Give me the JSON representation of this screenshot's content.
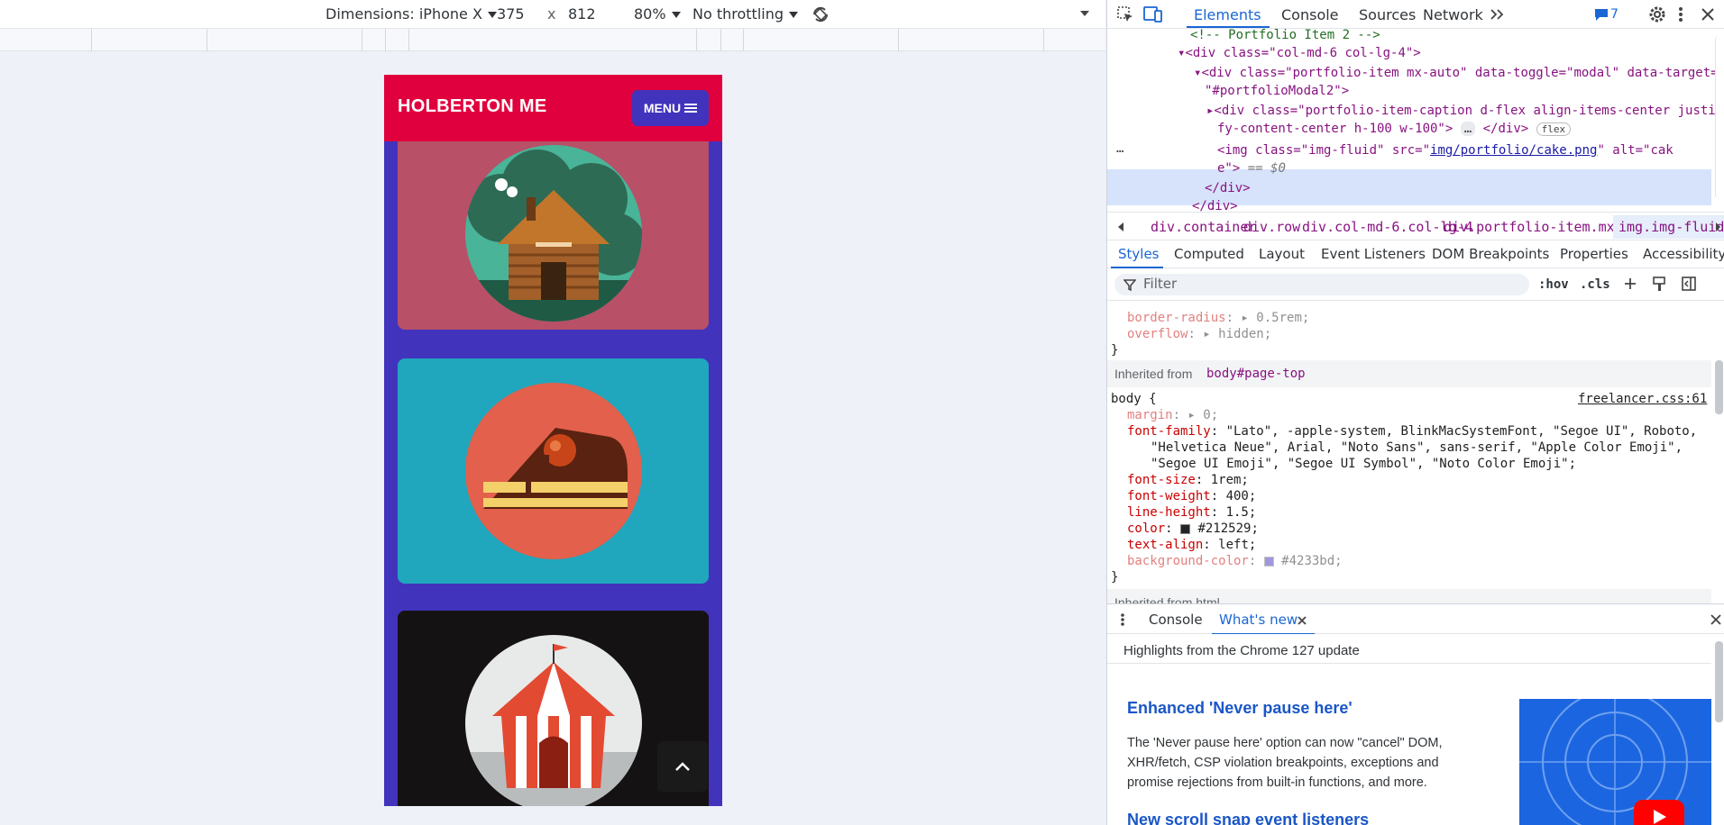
{
  "device_toolbar": {
    "dimensions_label": "Dimensions: iPhone X",
    "width": "375",
    "times": "x",
    "height": "812",
    "zoom": "80%",
    "throttling": "No throttling"
  },
  "phone": {
    "brand": "HOLBERTON ME",
    "menu_label": "MENU",
    "cards": [
      {
        "name": "cabin",
        "bg": "#b85068",
        "circle": "#49b497"
      },
      {
        "name": "cake",
        "bg": "#20a6bd",
        "circle": "#e2604c"
      },
      {
        "name": "circus",
        "bg": "#151213",
        "circle": "#e8eaea"
      }
    ],
    "colors": {
      "navbar": "#e0003d",
      "page_bg": "#4233bd"
    }
  },
  "devtools": {
    "tabs": [
      "Elements",
      "Console",
      "Sources",
      "Network"
    ],
    "active_tab": "Elements",
    "issues_count": "7",
    "dom": {
      "comment": "<!-- Portfolio Item 2 -->",
      "line2_tag": "<div class=\"col-md-6 col-lg-4\">",
      "line3a": "<div class=\"portfolio-item mx-auto\" data-toggle=\"modal\" data-target=",
      "line3b": "\"#portfolioModal2\">",
      "line4a": "<div class=\"portfolio-item-caption d-flex align-items-center justi",
      "line4b": "fy-content-center h-100 w-100\">",
      "line4_close": "</div>",
      "flex_badge": "flex",
      "img_a_start": "<img class=\"img-fluid\" src=\"",
      "img_src": "img/portfolio/cake.png",
      "img_a_end": "\" alt=\"cak",
      "img_b": "e\">",
      "img_eq": "== $0",
      "close_div1": "</div>",
      "close_div2": "</div>"
    },
    "breadcrumbs": [
      "div.container",
      "div.row",
      "div.col-md-6.col-lg-4",
      "div.portfolio-item.mx-auto",
      "img.img-fluid"
    ],
    "style_tabs": [
      "Styles",
      "Computed",
      "Layout",
      "Event Listeners",
      "DOM Breakpoints",
      "Properties",
      "Accessibility"
    ],
    "filter_placeholder": "Filter",
    "hov": ":hov",
    "cls": ".cls",
    "styles": {
      "top_props": [
        {
          "name": "border-radius",
          "value": "0.5rem"
        },
        {
          "name": "overflow",
          "value": "hidden"
        }
      ],
      "inherited_label": "Inherited from",
      "inherited_from": "body#page-top",
      "selector": "body {",
      "source": "freelancer.css:61",
      "body_props": [
        {
          "name": "margin",
          "value": "0;"
        },
        {
          "name": "font-family",
          "value": "\"Lato\", -apple-system, BlinkMacSystemFont, \"Segoe UI\", Roboto,"
        },
        {
          "name": "",
          "value": "\"Helvetica Neue\", Arial, \"Noto Sans\", sans-serif, \"Apple Color Emoji\","
        },
        {
          "name": "",
          "value": "\"Segoe UI Emoji\", \"Segoe UI Symbol\", \"Noto Color Emoji\";"
        },
        {
          "name": "font-size",
          "value": "1rem;"
        },
        {
          "name": "font-weight",
          "value": "400;"
        },
        {
          "name": "line-height",
          "value": "1.5;"
        },
        {
          "name": "color",
          "value": "#212529;"
        },
        {
          "name": "text-align",
          "value": "left;"
        },
        {
          "name": "background-color",
          "value": "#4233bd;"
        }
      ],
      "closing": "}",
      "inherited_html": "Inherited from html"
    },
    "drawer": {
      "tabs": [
        "Console",
        "What's new"
      ],
      "highlights": "Highlights from the Chrome 127 update",
      "article1_title": "Enhanced 'Never pause here'",
      "article1_body": "The 'Never pause here' option can now \"cancel\" DOM, XHR/fetch, CSP violation breakpoints, exceptions and promise rejections from built-in functions, and more.",
      "article2_title": "New scroll snap event listeners"
    }
  }
}
